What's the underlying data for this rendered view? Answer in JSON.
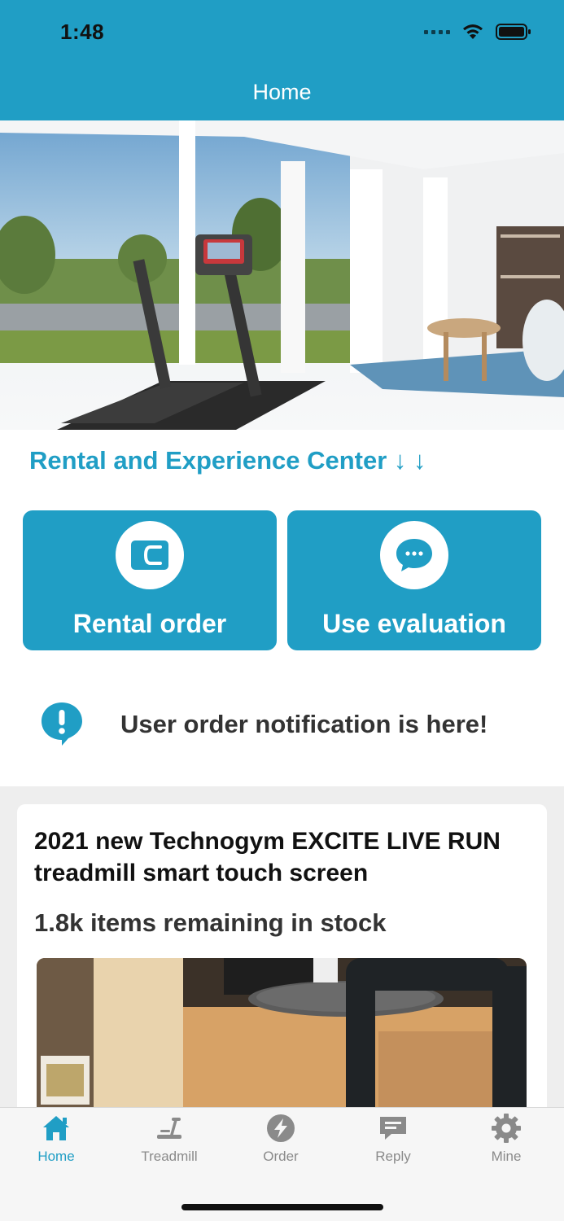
{
  "status_bar": {
    "time": "1:48"
  },
  "nav": {
    "title": "Home"
  },
  "section": {
    "heading": "Rental and Experience Center ↓ ↓"
  },
  "actions": [
    {
      "label": "Rental order",
      "icon": "wallet-icon"
    },
    {
      "label": "Use evaluation",
      "icon": "chat-bubble-icon"
    }
  ],
  "notice": {
    "text": "User order notification is here!",
    "icon": "alert-bubble-icon"
  },
  "product": {
    "title": "2021 new Technogym EXCITE LIVE RUN treadmill smart touch screen",
    "stock": "1.8k items remaining in stock"
  },
  "tabs": [
    {
      "label": "Home",
      "icon": "home-icon",
      "active": true
    },
    {
      "label": "Treadmill",
      "icon": "treadmill-icon",
      "active": false
    },
    {
      "label": "Order",
      "icon": "lightning-icon",
      "active": false
    },
    {
      "label": "Reply",
      "icon": "message-icon",
      "active": false
    },
    {
      "label": "Mine",
      "icon": "gear-icon",
      "active": false
    }
  ],
  "colors": {
    "primary": "#209ec5",
    "text_dark": "#333333",
    "tab_inactive": "#8a8a8a",
    "feed_bg": "#eeeeee"
  }
}
